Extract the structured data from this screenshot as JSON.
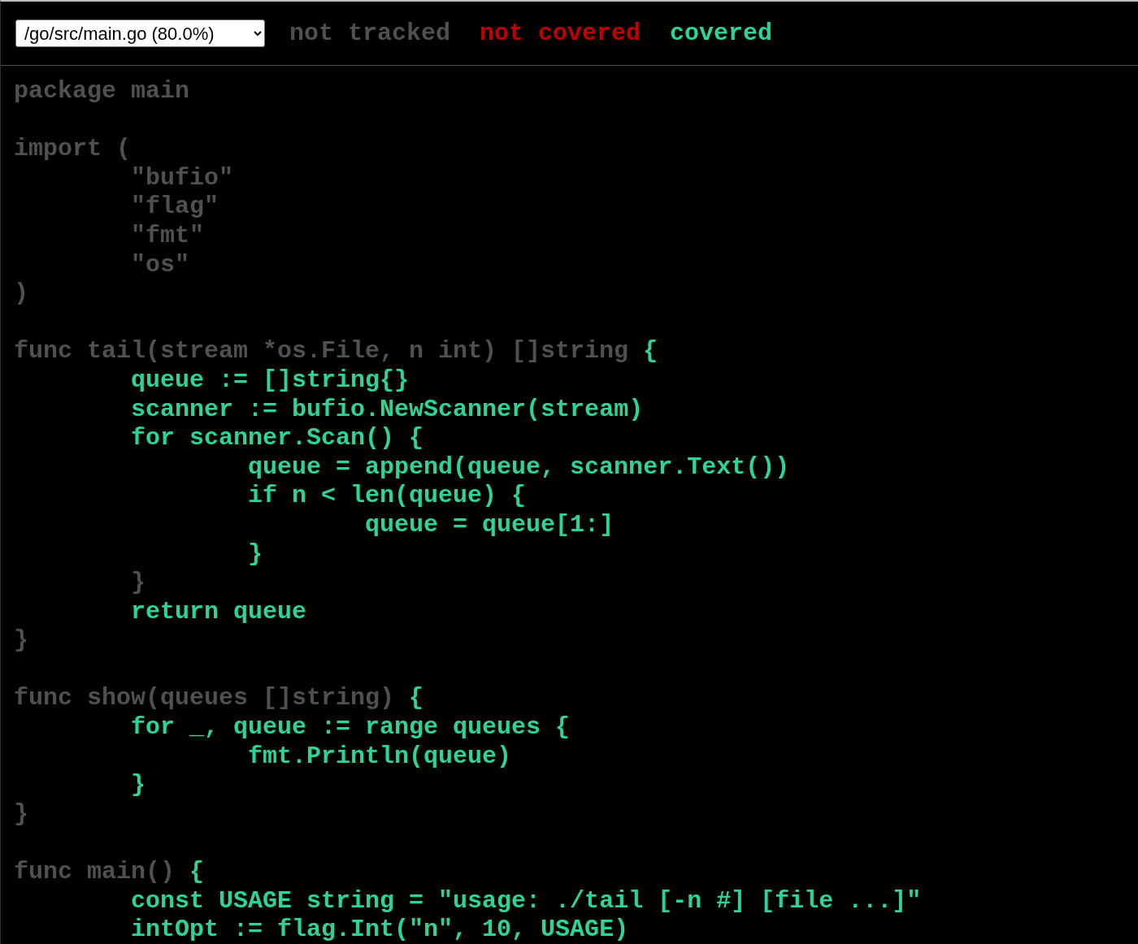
{
  "file_select": {
    "value": "/go/src/main.go (80.0%)"
  },
  "legend": [
    {
      "kind": "not_tracked",
      "label": "not tracked"
    },
    {
      "kind": "not_covered",
      "label": "not covered"
    },
    {
      "kind": "covered",
      "label": "covered"
    }
  ],
  "code_lines": [
    {
      "kind": "code",
      "segments": [
        {
          "kind": "not_tracked",
          "text": "package main"
        }
      ]
    },
    {
      "kind": "blank"
    },
    {
      "kind": "code",
      "segments": [
        {
          "kind": "not_tracked",
          "text": "import ("
        }
      ]
    },
    {
      "kind": "code",
      "segments": [
        {
          "kind": "not_tracked",
          "text": "\t\"bufio\""
        }
      ]
    },
    {
      "kind": "code",
      "segments": [
        {
          "kind": "not_tracked",
          "text": "\t\"flag\""
        }
      ]
    },
    {
      "kind": "code",
      "segments": [
        {
          "kind": "not_tracked",
          "text": "\t\"fmt\""
        }
      ]
    },
    {
      "kind": "code",
      "segments": [
        {
          "kind": "not_tracked",
          "text": "\t\"os\""
        }
      ]
    },
    {
      "kind": "code",
      "segments": [
        {
          "kind": "not_tracked",
          "text": ")"
        }
      ]
    },
    {
      "kind": "blank"
    },
    {
      "kind": "code",
      "segments": [
        {
          "kind": "not_tracked",
          "text": "func tail(stream *os.File, n int) []string "
        },
        {
          "kind": "covered",
          "text": "{"
        }
      ]
    },
    {
      "kind": "code",
      "segments": [
        {
          "kind": "covered",
          "text": "\tqueue := []string{}"
        }
      ]
    },
    {
      "kind": "code",
      "segments": [
        {
          "kind": "covered",
          "text": "\tscanner := bufio.NewScanner(stream)"
        }
      ]
    },
    {
      "kind": "code",
      "segments": [
        {
          "kind": "covered",
          "text": "\tfor scanner.Scan() {"
        }
      ]
    },
    {
      "kind": "code",
      "segments": [
        {
          "kind": "covered",
          "text": "\t\tqueue = append(queue, scanner.Text())"
        }
      ]
    },
    {
      "kind": "code",
      "segments": [
        {
          "kind": "covered",
          "text": "\t\tif n < len(queue) {"
        }
      ]
    },
    {
      "kind": "code",
      "segments": [
        {
          "kind": "covered",
          "text": "\t\t\tqueue = queue[1:]"
        }
      ]
    },
    {
      "kind": "code",
      "segments": [
        {
          "kind": "covered",
          "text": "\t\t}"
        }
      ]
    },
    {
      "kind": "code",
      "segments": [
        {
          "kind": "not_tracked",
          "text": "\t}"
        }
      ]
    },
    {
      "kind": "code",
      "segments": [
        {
          "kind": "covered",
          "text": "\treturn queue"
        }
      ]
    },
    {
      "kind": "code",
      "segments": [
        {
          "kind": "not_tracked",
          "text": "}"
        }
      ]
    },
    {
      "kind": "blank"
    },
    {
      "kind": "code",
      "segments": [
        {
          "kind": "not_tracked",
          "text": "func show(queues []string) "
        },
        {
          "kind": "covered",
          "text": "{"
        }
      ]
    },
    {
      "kind": "code",
      "segments": [
        {
          "kind": "covered",
          "text": "\tfor _, queue := range queues {"
        }
      ]
    },
    {
      "kind": "code",
      "segments": [
        {
          "kind": "covered",
          "text": "\t\tfmt.Println(queue)"
        }
      ]
    },
    {
      "kind": "code",
      "segments": [
        {
          "kind": "covered",
          "text": "\t}"
        }
      ]
    },
    {
      "kind": "code",
      "segments": [
        {
          "kind": "not_tracked",
          "text": "}"
        }
      ]
    },
    {
      "kind": "blank"
    },
    {
      "kind": "code",
      "segments": [
        {
          "kind": "not_tracked",
          "text": "func main() "
        },
        {
          "kind": "covered",
          "text": "{"
        }
      ]
    },
    {
      "kind": "code",
      "segments": [
        {
          "kind": "covered",
          "text": "\tconst USAGE string = \"usage: ./tail [-n #] [file ...]\""
        }
      ]
    },
    {
      "kind": "code",
      "segments": [
        {
          "kind": "covered",
          "text": "\tintOpt := flag.Int(\"n\", 10, USAGE)"
        }
      ]
    }
  ]
}
